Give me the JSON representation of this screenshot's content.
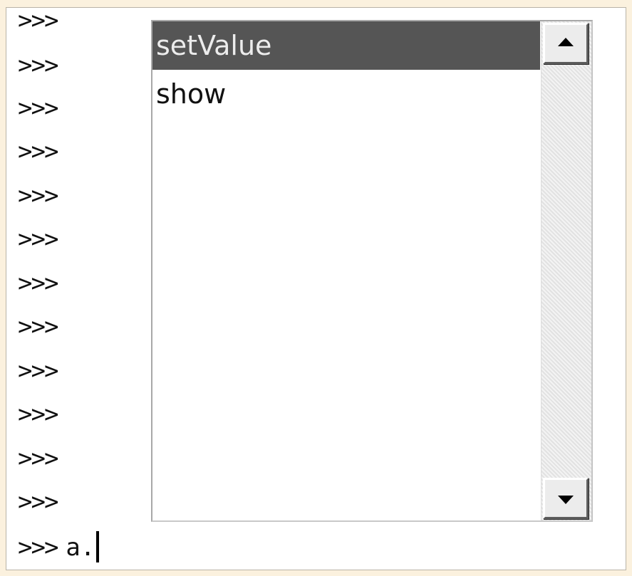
{
  "console": {
    "prompt": ">>>",
    "current_input": "a."
  },
  "autocomplete": {
    "items": [
      {
        "label": "setValue",
        "selected": true
      },
      {
        "label": "show",
        "selected": false
      }
    ]
  },
  "colors": {
    "page_background": "#fbf1de",
    "selection_background": "#555555",
    "selection_text": "#ececec"
  },
  "icons": {
    "scroll_up": "scroll-up-arrow-icon",
    "scroll_down": "scroll-down-arrow-icon"
  }
}
